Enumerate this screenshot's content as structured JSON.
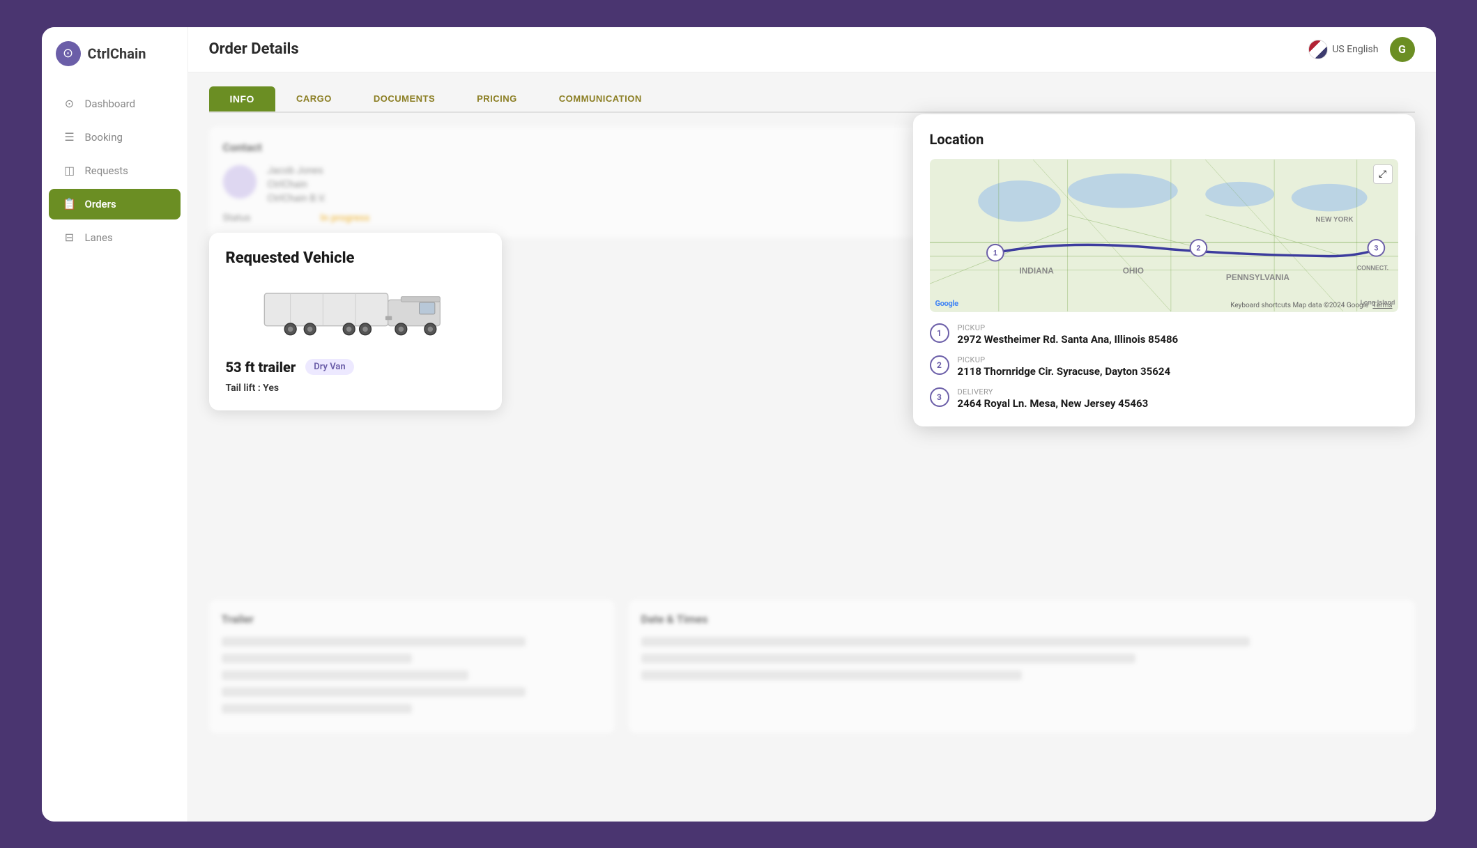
{
  "app": {
    "name": "CtrlChain",
    "logo_symbol": "⊙"
  },
  "topbar": {
    "title": "Order Details",
    "lang": "US English",
    "user_initial": "G"
  },
  "sidebar": {
    "items": [
      {
        "id": "dashboard",
        "label": "Dashboard",
        "icon": "⊙"
      },
      {
        "id": "booking",
        "label": "Booking",
        "icon": "☰"
      },
      {
        "id": "requests",
        "label": "Requests",
        "icon": "◫"
      },
      {
        "id": "orders",
        "label": "Orders",
        "icon": "📋",
        "active": true
      },
      {
        "id": "lanes",
        "label": "Lanes",
        "icon": "⊟"
      }
    ]
  },
  "tabs": [
    {
      "id": "info",
      "label": "INFO",
      "active": true
    },
    {
      "id": "cargo",
      "label": "CARGO"
    },
    {
      "id": "documents",
      "label": "DOCUMENTS"
    },
    {
      "id": "pricing",
      "label": "PRICING"
    },
    {
      "id": "communication",
      "label": "COMMUNICATION"
    }
  ],
  "contact": {
    "section_title": "Contact",
    "name": "Jacob Jones",
    "company": "CtrlChain",
    "role": "CtrlChain B.V.",
    "status_label": "Status",
    "status_value": "In progress"
  },
  "vehicle_card": {
    "title": "Requested Vehicle",
    "size": "53 ft trailer",
    "type_badge": "Dry Van",
    "tail_lift_label": "Tail lift :",
    "tail_lift_value": "Yes"
  },
  "location_modal": {
    "title": "Location",
    "map_google_text": "Google",
    "map_footer": "Keyboard shortcuts   Map data ©2024 Google",
    "map_terms": "Terms",
    "expand_icon": "⤢",
    "stops": [
      {
        "num": "1",
        "type": "Pickup",
        "address": "2972 Westheimer Rd. Santa Ana, Illinois 85486"
      },
      {
        "num": "2",
        "type": "Pickup",
        "address": "2118 Thornridge Cir. Syracuse, Dayton 35624"
      },
      {
        "num": "3",
        "type": "Delivery",
        "address": "2464 Royal Ln. Mesa, New Jersey 45463"
      }
    ]
  },
  "dates_section": {
    "title": "Date & Times"
  },
  "trailer_section": {
    "title": "Trailer",
    "rows": [
      "Vehicle Type: Standard Trailer",
      "Body Type: None",
      "Owner: Benny Carrier",
      "License Plate: abcdefde",
      "Subtitle: —"
    ]
  }
}
